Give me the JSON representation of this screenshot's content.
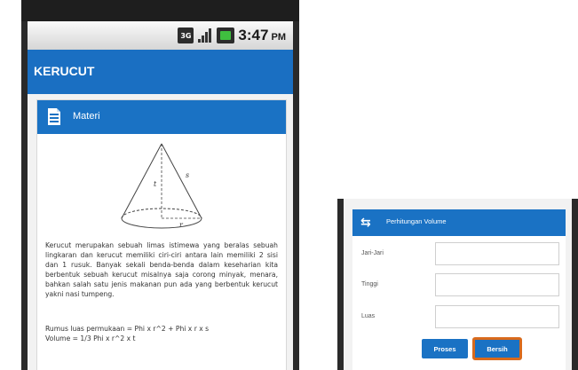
{
  "left_screen": {
    "status_bar": {
      "network_icon": "3g-icon",
      "network_text": "3G",
      "signal_icon": "signal-icon",
      "battery_icon": "battery-icon",
      "time": "3:47",
      "ampm": "PM"
    },
    "app_title": "KERUCUT",
    "card": {
      "header_icon": "document-icon",
      "header_label": "Materi",
      "diagram_labels": {
        "slant": "s",
        "height": "t",
        "radius": "r"
      },
      "description": "Kerucut merupakan sebuah limas istimewa yang beralas sebuah lingkaran dan kerucut memiliki ciri-ciri antara lain memiliki 2 sisi dan 1 rusuk. Banyak sekali benda-benda dalam keseharian kita berbentuk sebuah kerucut misalnya saja corong minyak, menara, bahkan salah satu jenis makanan pun ada yang berbentuk kerucut yakni nasi tumpeng.",
      "formula_surface": "Rumus luas permukaan = Phi x r^2 + Phi x r x s",
      "formula_volume": "Volume = 1/3 Phi x r^2 x t"
    }
  },
  "right_screen": {
    "card": {
      "header_icon": "calculate-icon",
      "header_label": "Perhitungan Volume",
      "fields": [
        {
          "label": "Jari-Jari",
          "value": ""
        },
        {
          "label": "Tinggi",
          "value": ""
        },
        {
          "label": "Luas",
          "value": ""
        }
      ],
      "process_button": "Proses",
      "clear_button": "Bersih"
    }
  },
  "colors": {
    "primary": "#1a72c4",
    "accent_border": "#d96a1c",
    "status_bar": "#e6e6e6"
  }
}
